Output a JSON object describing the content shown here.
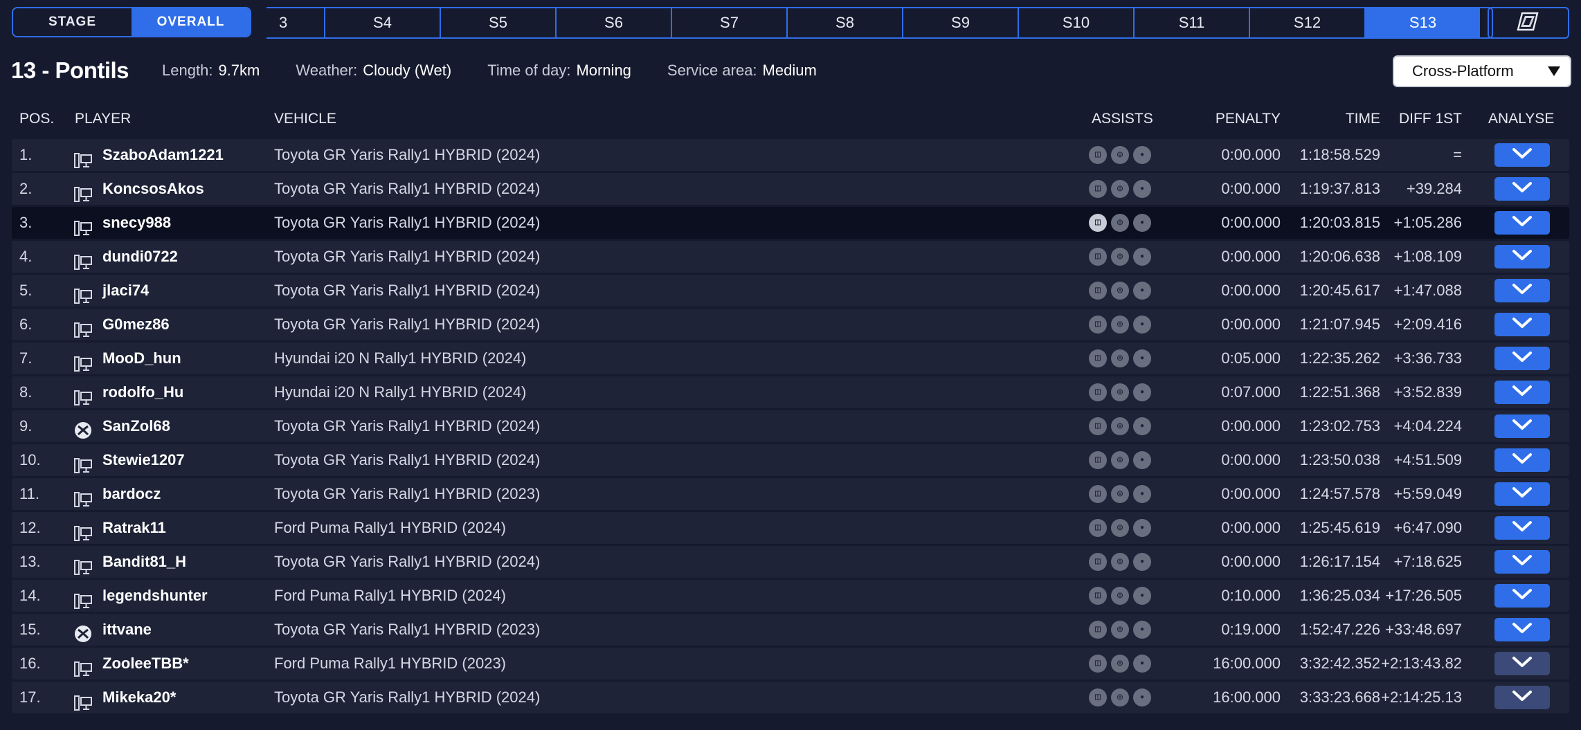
{
  "toggle": {
    "stage": "STAGE",
    "overall": "OVERALL"
  },
  "stage_tabs": [
    "3",
    "S4",
    "S5",
    "S6",
    "S7",
    "S8",
    "S9",
    "S10",
    "S11",
    "S12",
    "S13"
  ],
  "active_stage": "S13",
  "stage_info": {
    "title": "13 - Pontils",
    "length_label": "Length:",
    "length_value": "9.7km",
    "weather_label": "Weather:",
    "weather_value": "Cloudy (Wet)",
    "tod_label": "Time of day:",
    "tod_value": "Morning",
    "service_label": "Service area:",
    "service_value": "Medium"
  },
  "platform_select": {
    "value": "Cross-Platform"
  },
  "columns": {
    "pos": "POS.",
    "player": "PLAYER",
    "vehicle": "VEHICLE",
    "assists": "ASSISTS",
    "penalty": "PENALTY",
    "time": "TIME",
    "diff": "DIFF 1ST",
    "analyse": "ANALYSE"
  },
  "rows": [
    {
      "pos": "1.",
      "platform": "pc-icon",
      "player": "SzaboAdam1221",
      "vehicle": "Toyota GR Yaris Rally1 HYBRID (2024)",
      "penalty": "0:00.000",
      "time": "1:18:58.529",
      "diff": "="
    },
    {
      "pos": "2.",
      "platform": "pc-icon",
      "player": "KoncsosAkos",
      "vehicle": "Toyota GR Yaris Rally1 HYBRID (2024)",
      "penalty": "0:00.000",
      "time": "1:19:37.813",
      "diff": "+39.284"
    },
    {
      "pos": "3.",
      "platform": "pc-icon",
      "player": "snecy988",
      "vehicle": "Toyota GR Yaris Rally1 HYBRID (2024)",
      "penalty": "0:00.000",
      "time": "1:20:03.815",
      "diff": "+1:05.286"
    },
    {
      "pos": "4.",
      "platform": "pc-icon",
      "player": "dundi0722",
      "vehicle": "Toyota GR Yaris Rally1 HYBRID (2024)",
      "penalty": "0:00.000",
      "time": "1:20:06.638",
      "diff": "+1:08.109"
    },
    {
      "pos": "5.",
      "platform": "pc-icon",
      "player": "jlaci74",
      "vehicle": "Toyota GR Yaris Rally1 HYBRID (2024)",
      "penalty": "0:00.000",
      "time": "1:20:45.617",
      "diff": "+1:47.088"
    },
    {
      "pos": "6.",
      "platform": "pc-icon",
      "player": "G0mez86",
      "vehicle": "Toyota GR Yaris Rally1 HYBRID (2024)",
      "penalty": "0:00.000",
      "time": "1:21:07.945",
      "diff": "+2:09.416"
    },
    {
      "pos": "7.",
      "platform": "pc-icon",
      "player": "MooD_hun",
      "vehicle": "Hyundai i20 N Rally1 HYBRID (2024)",
      "penalty": "0:05.000",
      "time": "1:22:35.262",
      "diff": "+3:36.733"
    },
    {
      "pos": "8.",
      "platform": "pc-icon",
      "player": "rodolfo_Hu",
      "vehicle": "Hyundai i20 N Rally1 HYBRID (2024)",
      "penalty": "0:07.000",
      "time": "1:22:51.368",
      "diff": "+3:52.839"
    },
    {
      "pos": "9.",
      "platform": "xbox-icon",
      "player": "SanZol68",
      "vehicle": "Toyota GR Yaris Rally1 HYBRID (2024)",
      "penalty": "0:00.000",
      "time": "1:23:02.753",
      "diff": "+4:04.224"
    },
    {
      "pos": "10.",
      "platform": "pc-icon",
      "player": "Stewie1207",
      "vehicle": "Toyota GR Yaris Rally1 HYBRID (2024)",
      "penalty": "0:00.000",
      "time": "1:23:50.038",
      "diff": "+4:51.509"
    },
    {
      "pos": "11.",
      "platform": "pc-icon",
      "player": "bardocz",
      "vehicle": "Toyota GR Yaris Rally1 HYBRID (2023)",
      "penalty": "0:00.000",
      "time": "1:24:57.578",
      "diff": "+5:59.049"
    },
    {
      "pos": "12.",
      "platform": "pc-icon",
      "player": "Ratrak11",
      "vehicle": "Ford Puma Rally1 HYBRID (2024)",
      "penalty": "0:00.000",
      "time": "1:25:45.619",
      "diff": "+6:47.090"
    },
    {
      "pos": "13.",
      "platform": "pc-icon",
      "player": "Bandit81_H",
      "vehicle": "Toyota GR Yaris Rally1 HYBRID (2024)",
      "penalty": "0:00.000",
      "time": "1:26:17.154",
      "diff": "+7:18.625"
    },
    {
      "pos": "14.",
      "platform": "pc-icon",
      "player": "legendshunter",
      "vehicle": "Ford Puma Rally1 HYBRID (2024)",
      "penalty": "0:10.000",
      "time": "1:36:25.034",
      "diff": "+17:26.505"
    },
    {
      "pos": "15.",
      "platform": "xbox-icon",
      "player": "ittvane",
      "vehicle": "Toyota GR Yaris Rally1 HYBRID (2023)",
      "penalty": "0:19.000",
      "time": "1:52:47.226",
      "diff": "+33:48.697"
    },
    {
      "pos": "16.",
      "platform": "pc-icon",
      "player": "ZooleeTBB*",
      "vehicle": "Ford Puma Rally1 HYBRID (2023)",
      "penalty": "16:00.000",
      "time": "3:32:42.352",
      "diff": "+2:13:43.82"
    },
    {
      "pos": "17.",
      "platform": "pc-icon",
      "player": "Mikeka20*",
      "vehicle": "Toyota GR Yaris Rally1 HYBRID (2024)",
      "penalty": "16:00.000",
      "time": "3:33:23.668",
      "diff": "+2:14:25.13"
    }
  ],
  "colors": {
    "accent": "#2f6ee8",
    "background": "#161a2e",
    "row": "#1e2337",
    "row_highlight": "#0c0f1f"
  }
}
